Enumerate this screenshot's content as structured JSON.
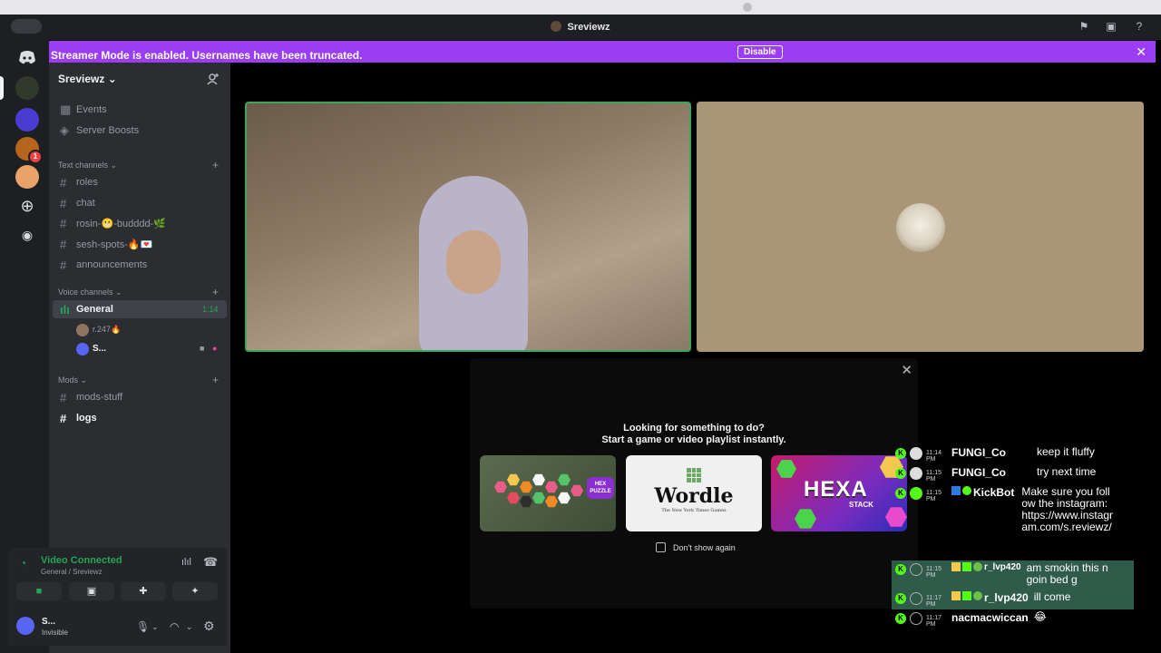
{
  "window": {
    "title": "Sreviewz"
  },
  "banner": {
    "message": "Streamer Mode is enabled. Usernames have been truncated.",
    "button": "Disable"
  },
  "rail": {
    "notification_count": "1"
  },
  "server": {
    "name": "Sreviewz",
    "top_items": [
      {
        "label": "Events"
      },
      {
        "label": "Server Boosts"
      }
    ],
    "text_category": "Text channels",
    "text_channels": [
      {
        "label": "roles"
      },
      {
        "label": "chat"
      },
      {
        "label": "rosin-😬-budddd-🌿"
      },
      {
        "label": "sesh-spots-🔥💌"
      },
      {
        "label": "announcements"
      }
    ],
    "voice_category": "Voice channels",
    "voice_channel": {
      "label": "General",
      "timer": "1:14"
    },
    "voice_users": [
      {
        "name": "r.247🔥"
      },
      {
        "name": "S..."
      }
    ],
    "mods_category": "Mods",
    "mods_channels": [
      {
        "label": "mods-stuff"
      },
      {
        "label": "logs"
      }
    ]
  },
  "voice_panel": {
    "status": "Video Connected",
    "location": "General / Sreviewz"
  },
  "user": {
    "name": "S...",
    "status": "Invisible"
  },
  "popup": {
    "title_line1": "Looking for something to do?",
    "title_line2": "Start a game or video playlist instantly.",
    "cards": [
      {
        "name": "HEX PUZZLE"
      },
      {
        "name": "Wordle",
        "subtitle": "The New York Times Games"
      },
      {
        "name": "HEXA",
        "subtitle": "STACK"
      }
    ],
    "dont_show": "Don't show again"
  },
  "chat": [
    {
      "time": "11:14 PM",
      "user": "FUNGI_Co",
      "text": "keep it fluffy",
      "highlight": false
    },
    {
      "time": "11:15 PM",
      "user": "FUNGI_Co",
      "text": "try next time",
      "highlight": false
    },
    {
      "time": "11:15 PM",
      "user": "KickBot",
      "text": "Make sure you follow the instagram: https://www.instagram.com/s.reviewz/",
      "highlight": false
    },
    {
      "time": "11:15 PM",
      "user": "r_lvp420",
      "text": "am smokin this n goin bed g",
      "highlight": true
    },
    {
      "time": "11:17 PM",
      "user": "r_lvp420",
      "text": "ill come",
      "highlight": true
    },
    {
      "time": "11:17 PM",
      "user": "nacmacwiccan",
      "text": "😂",
      "highlight": false
    }
  ],
  "colors": {
    "brand": "#5865f2",
    "banner": "#9b3df5",
    "voice_green": "#23a55a",
    "kick_green": "#53fc18"
  }
}
